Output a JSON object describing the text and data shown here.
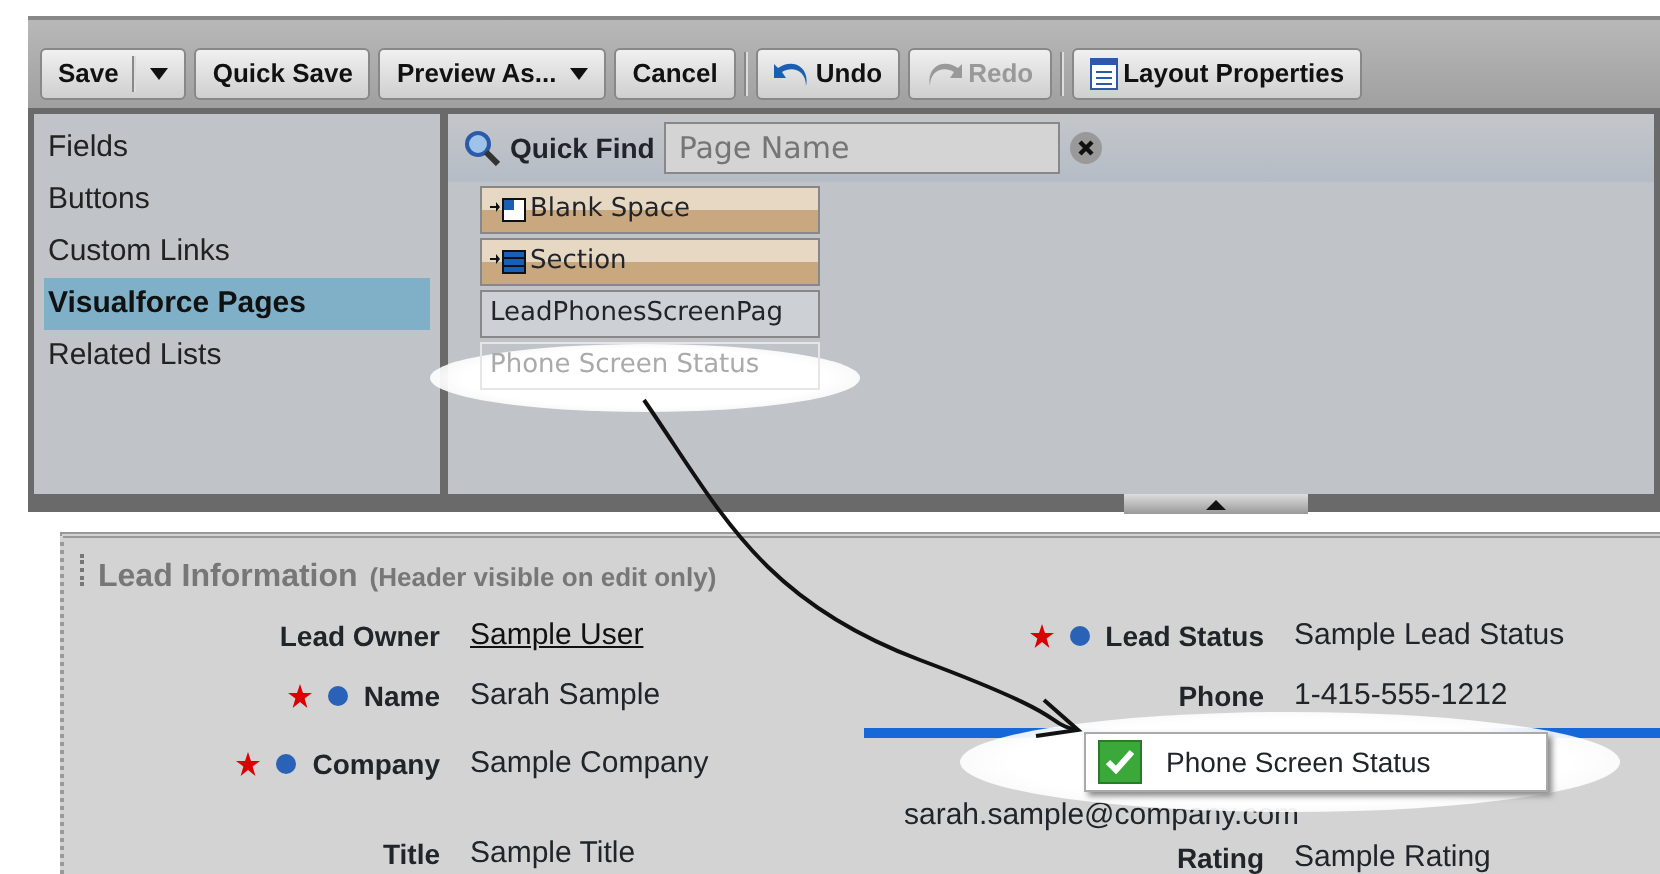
{
  "toolbar": {
    "buttons": [
      {
        "label": "Save",
        "kind": "split",
        "disabled": false
      },
      {
        "label": "Quick Save",
        "kind": "plain",
        "disabled": false
      },
      {
        "label": "Preview As...",
        "kind": "dropdown",
        "disabled": false
      },
      {
        "label": "Cancel",
        "kind": "plain",
        "disabled": false
      },
      {
        "label": "Undo",
        "kind": "undo",
        "disabled": false
      },
      {
        "label": "Redo",
        "kind": "redo",
        "disabled": true
      },
      {
        "label": "Layout Properties",
        "kind": "properties",
        "disabled": false
      }
    ]
  },
  "palette": {
    "categories": [
      {
        "label": "Fields",
        "selected": false
      },
      {
        "label": "Buttons",
        "selected": false
      },
      {
        "label": "Custom Links",
        "selected": false
      },
      {
        "label": "Visualforce Pages",
        "selected": true
      },
      {
        "label": "Related Lists",
        "selected": false
      }
    ],
    "quick_find": {
      "label": "Quick Find",
      "placeholder": "Page Name"
    },
    "items": [
      {
        "label": "Blank Space",
        "kind": "blank-space",
        "dragging": false
      },
      {
        "label": "Section",
        "kind": "section",
        "dragging": false
      },
      {
        "label": "LeadPhonesScreenPag",
        "kind": "page",
        "dragging": false
      },
      {
        "label": "Phone Screen Status",
        "kind": "page",
        "dragging": true
      }
    ]
  },
  "section": {
    "title": "Lead Information",
    "note": "(Header visible on edit only)",
    "left_fields": [
      {
        "label": "Lead Owner",
        "value": "Sample User",
        "required": false,
        "dot": false,
        "link": true
      },
      {
        "label": "Name",
        "value": "Sarah Sample",
        "required": true,
        "dot": true,
        "link": false
      },
      {
        "label": "Company",
        "value": "Sample Company",
        "required": true,
        "dot": true,
        "link": false
      },
      {
        "label": "Title",
        "value": "Sample Title",
        "required": false,
        "dot": false,
        "link": false
      }
    ],
    "right_fields": [
      {
        "label": "Lead Status",
        "value": "Sample Lead Status",
        "required": true,
        "dot": true,
        "drop_after": false
      },
      {
        "label": "Phone",
        "value": "1-415-555-1212",
        "required": false,
        "dot": false,
        "drop_after": true
      },
      {
        "value": "sarah.sample@company.com",
        "required": false,
        "dot": false,
        "drop_after": false
      },
      {
        "label": "Rating",
        "value": "Sample Rating",
        "required": false,
        "dot": false,
        "drop_after": false
      }
    ]
  },
  "drag_preview": {
    "label": "Phone Screen Status",
    "checked": true
  }
}
